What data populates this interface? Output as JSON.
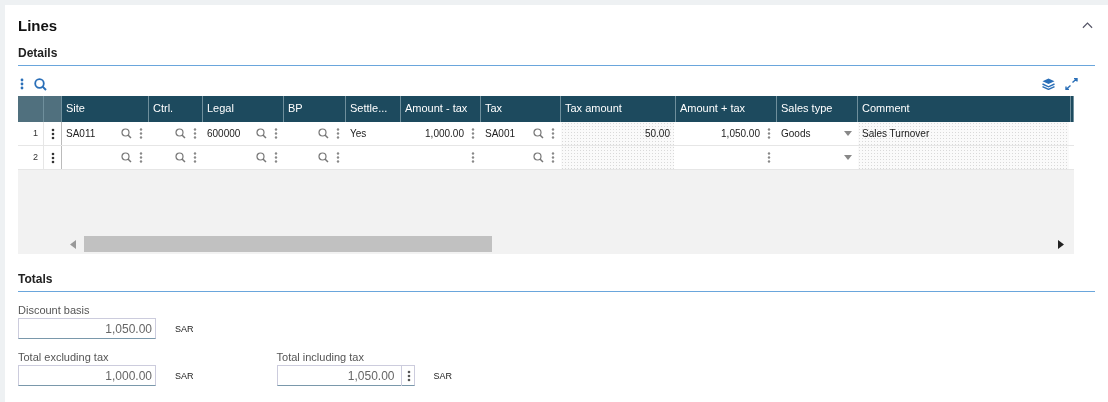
{
  "section": {
    "title": "Lines",
    "expanded": true
  },
  "details": {
    "title": "Details",
    "columns": [
      {
        "label": "Site",
        "kind": "lookup"
      },
      {
        "label": "Ctrl.",
        "kind": "lookup"
      },
      {
        "label": "Legal",
        "kind": "lookup"
      },
      {
        "label": "BP",
        "kind": "lookup"
      },
      {
        "label": "Settle...",
        "kind": "text"
      },
      {
        "label": "Amount - tax",
        "kind": "number-menu"
      },
      {
        "label": "Tax",
        "kind": "lookup"
      },
      {
        "label": "Tax amount",
        "kind": "readonly-number"
      },
      {
        "label": "Amount + tax",
        "kind": "number-menu"
      },
      {
        "label": "Sales type",
        "kind": "select"
      },
      {
        "label": "Comment",
        "kind": "readonly-text"
      }
    ],
    "rows": [
      {
        "number": "1",
        "cells": [
          "SA011",
          null,
          "600000",
          null,
          "Yes",
          "1,000.00",
          "SA001",
          "50.00",
          "1,050.00",
          "Goods",
          "Sales Turnover"
        ]
      },
      {
        "number": "2",
        "cells": [
          null,
          null,
          null,
          null,
          null,
          null,
          null,
          null,
          null,
          null,
          null
        ]
      }
    ]
  },
  "totals": {
    "title": "Totals",
    "fields": [
      {
        "label": "Discount basis",
        "value": "1,050.00",
        "unit": "SAR",
        "menu": false
      },
      {
        "label": "Total excluding tax",
        "value": "1,000.00",
        "unit": "SAR",
        "menu": false
      },
      {
        "label": "Total including tax",
        "value": "1,050.00",
        "unit": "SAR",
        "menu": true
      }
    ]
  }
}
